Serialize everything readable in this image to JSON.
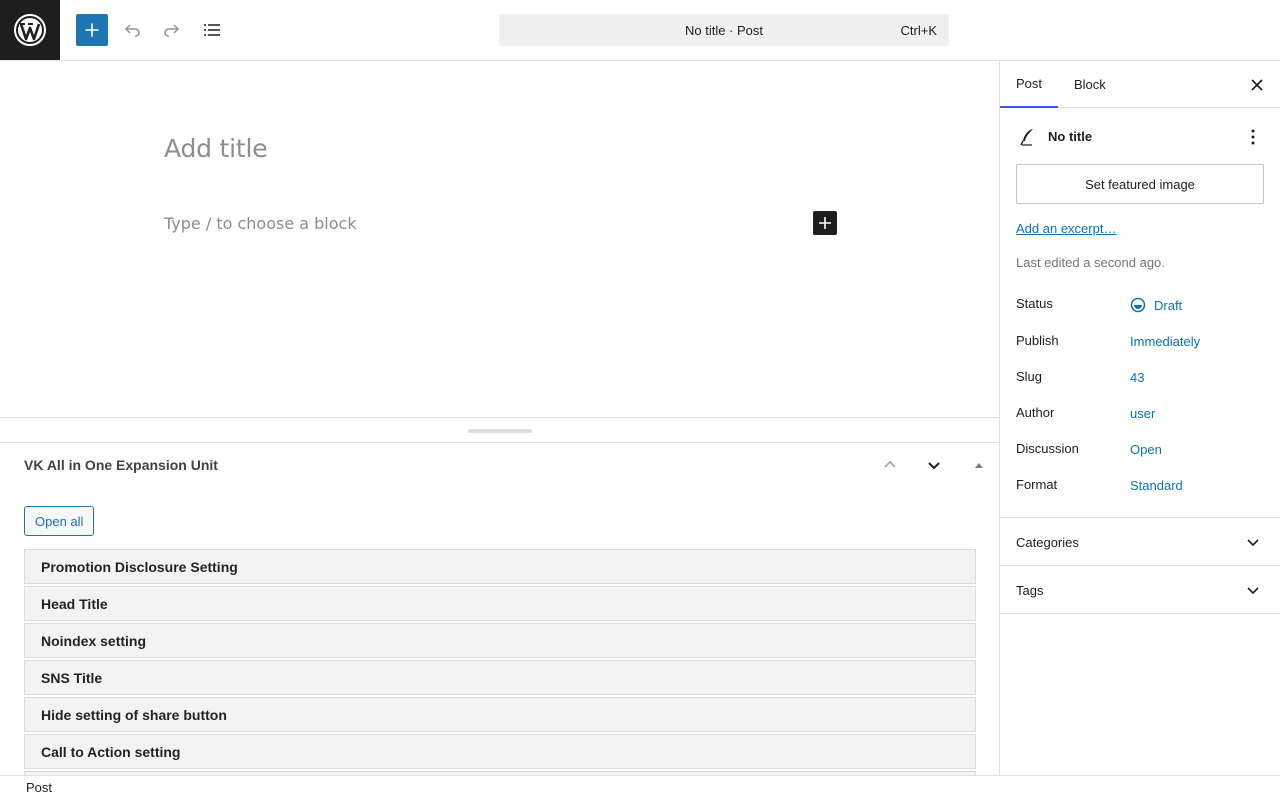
{
  "toolbar": {
    "logo_icon": "wordpress-logo-icon",
    "add_icon": "plus-icon",
    "undo_icon": "undo-icon",
    "redo_icon": "redo-icon",
    "list_view_icon": "document-overview-icon",
    "command_bar_label": "No title · Post",
    "command_shortcut": "Ctrl+K"
  },
  "editor": {
    "title_placeholder": "Add title",
    "block_placeholder": "Type / to choose a block"
  },
  "metabox": {
    "title": "VK All in One Expansion Unit",
    "open_all_label": "Open all",
    "sections": [
      "Promotion Disclosure Setting",
      "Head Title",
      "Noindex setting",
      "SNS Title",
      "Hide setting of share button",
      "Call to Action setting"
    ]
  },
  "footer": {
    "breadcrumb": "Post"
  },
  "sidebar": {
    "tabs": [
      "Post",
      "Block"
    ],
    "active_tab": "Post",
    "post_title": "No title",
    "featured_image_label": "Set featured image",
    "excerpt_link": "Add an excerpt…",
    "last_edited": "Last edited a second ago.",
    "fields": [
      {
        "label": "Status",
        "value": "Draft"
      },
      {
        "label": "Publish",
        "value": "Immediately"
      },
      {
        "label": "Slug",
        "value": "43"
      },
      {
        "label": "Author",
        "value": "user"
      },
      {
        "label": "Discussion",
        "value": "Open"
      },
      {
        "label": "Format",
        "value": "Standard"
      }
    ],
    "panels": [
      "Categories",
      "Tags"
    ]
  },
  "colors": {
    "accent": "#1e76b2",
    "link": "#0b72b5",
    "dark": "#1e1e1e",
    "tab_underline": "#3858e9"
  }
}
